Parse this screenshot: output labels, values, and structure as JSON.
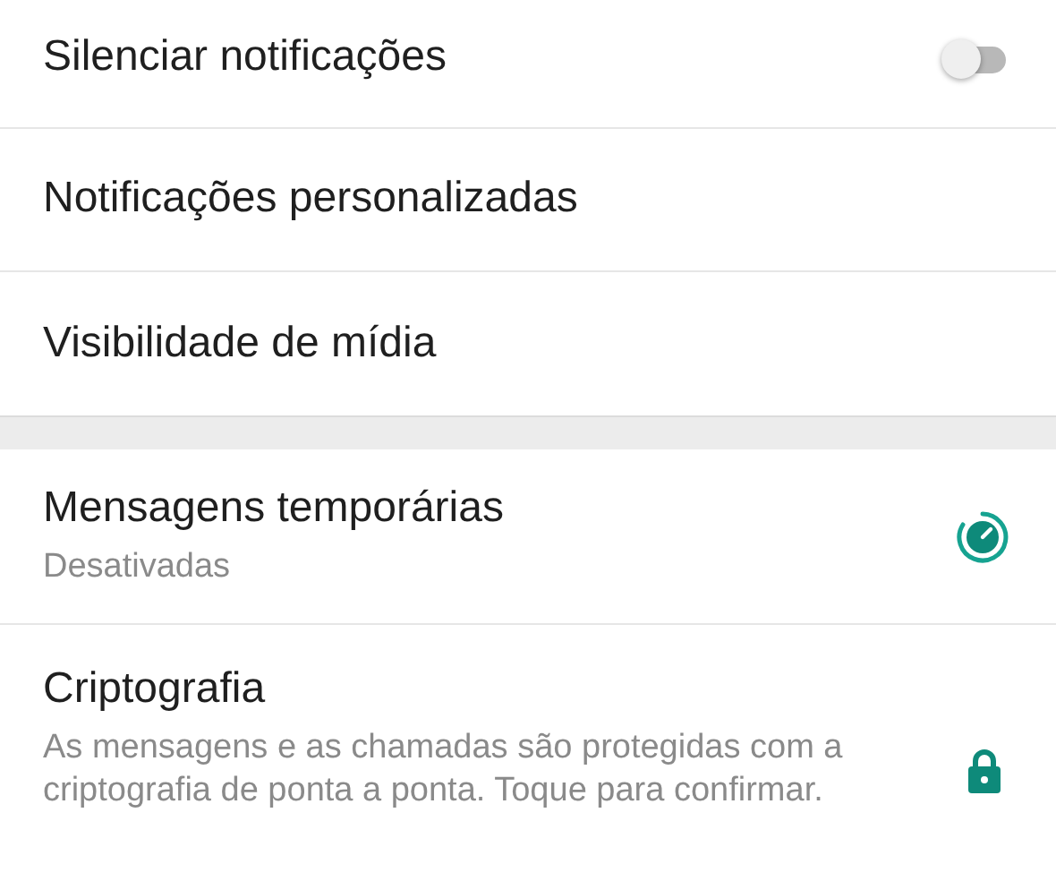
{
  "sections": [
    {
      "items": [
        {
          "kind": "toggle",
          "title": "Silenciar notificações",
          "on": false
        },
        {
          "kind": "plain",
          "title": "Notificações personalizadas"
        },
        {
          "kind": "plain",
          "title": "Visibilidade de mídia"
        }
      ]
    },
    {
      "items": [
        {
          "kind": "timer",
          "title": "Mensagens temporárias",
          "subtitle": "Desativadas"
        },
        {
          "kind": "lock",
          "title": "Criptografia",
          "subtitle": "As mensagens e as chamadas são protegidas com a criptografia de ponta a ponta. Toque para confirmar."
        }
      ]
    }
  ]
}
